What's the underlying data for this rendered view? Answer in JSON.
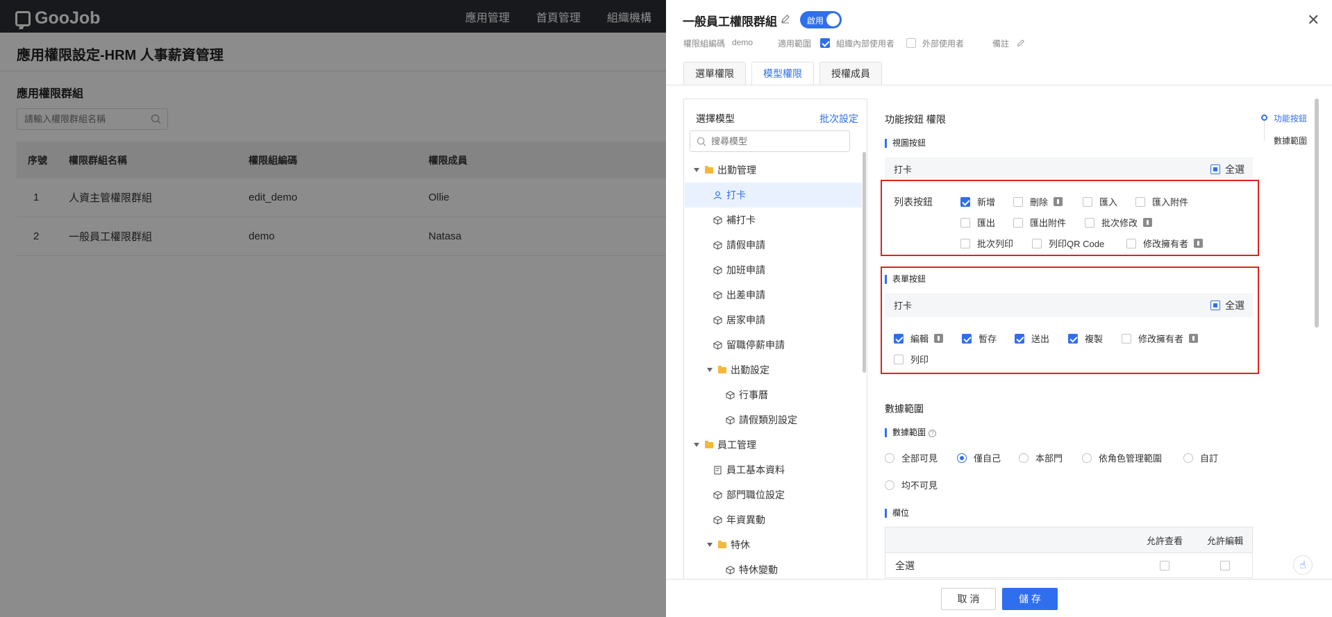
{
  "background": {
    "brand": "GooJob",
    "nav": [
      "應用管理",
      "首頁管理",
      "組織機構"
    ],
    "page_title": "應用權限設定-HRM 人事薪資管理",
    "section_title": "應用權限群組",
    "search_placeholder": "請輸入權限群組名稱",
    "table": {
      "headers": [
        "序號",
        "權限群組名稱",
        "權限組編碼",
        "權限成員"
      ],
      "rows": [
        [
          "1",
          "人資主管權限群組",
          "edit_demo",
          "Ollie"
        ],
        [
          "2",
          "一般員工權限群組",
          "demo",
          "Natasa"
        ]
      ]
    }
  },
  "drawer": {
    "title": "一般員工權限群組",
    "toggle_label": "啟用",
    "meta": {
      "code_label": "權限組編碼",
      "code_value": "demo",
      "scope_label": "適用範圍",
      "internal_label": "組織內部使用者",
      "external_label": "外部使用者",
      "note_label": "備註"
    },
    "tabs": [
      "選單權限",
      "模型權限",
      "授權成員"
    ],
    "tree": {
      "title": "選擇模型",
      "batch": "批次設定",
      "search_placeholder": "搜尋模型",
      "items": [
        {
          "label": "出勤管理",
          "kind": "folder"
        },
        {
          "label": "打卡",
          "kind": "user"
        },
        {
          "label": "補打卡",
          "kind": "cube"
        },
        {
          "label": "請假申請",
          "kind": "cube"
        },
        {
          "label": "加班申請",
          "kind": "cube"
        },
        {
          "label": "出差申請",
          "kind": "cube"
        },
        {
          "label": "居家申請",
          "kind": "cube"
        },
        {
          "label": "留職停薪申請",
          "kind": "cube"
        },
        {
          "label": "出勤設定",
          "kind": "folder"
        },
        {
          "label": "行事曆",
          "kind": "cube"
        },
        {
          "label": "請假類別設定",
          "kind": "cube"
        },
        {
          "label": "員工管理",
          "kind": "folder"
        },
        {
          "label": "員工基本資料",
          "kind": "doc"
        },
        {
          "label": "部門職位設定",
          "kind": "cube"
        },
        {
          "label": "年資異動",
          "kind": "cube"
        },
        {
          "label": "特休",
          "kind": "folder"
        },
        {
          "label": "特休變動",
          "kind": "cube"
        }
      ]
    },
    "content": {
      "func_title": "功能按鈕 權限",
      "view_buttons": "視圖按鈕",
      "model_name": "打卡",
      "select_all": "全選",
      "list_label": "列表按鈕",
      "list_options": [
        "新增",
        "刪除",
        "匯入",
        "匯入附件",
        "匯出",
        "匯出附件",
        "批次修改",
        "批次列印",
        "列印QR Code",
        "修改擁有者"
      ],
      "form_title": "表單按鈕",
      "form_options": [
        "編輯",
        "暫存",
        "送出",
        "複製",
        "修改擁有者",
        "列印"
      ],
      "data_title": "數據範圍",
      "data_sub": "數據範圍",
      "radio_options": [
        "全部可見",
        "僅自己",
        "本部門",
        "依角色管理範圍",
        "自訂",
        "均不可見"
      ],
      "field_title": "欄位",
      "field_headers": [
        "允許查看",
        "允許編輯"
      ],
      "field_row": "全選"
    },
    "anchors": [
      "功能按鈕",
      "數據範圍"
    ],
    "footer": {
      "cancel": "取 消",
      "save": "儲 存"
    }
  }
}
